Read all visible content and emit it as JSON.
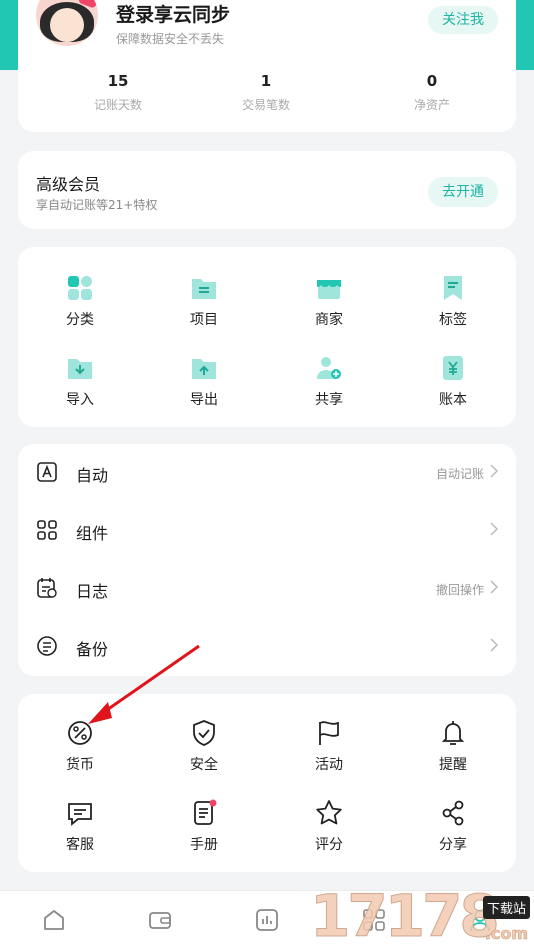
{
  "colors": {
    "accent": "#22c7b3",
    "accent_text": "#1db5a2",
    "pill_bg": "#e6f7f4",
    "annotation": "#e0141b"
  },
  "profile": {
    "name": "登录享云同步",
    "subtitle": "保障数据安全不丢失",
    "follow_label": "关注我",
    "stats": [
      {
        "value": "15",
        "label": "记账天数"
      },
      {
        "value": "1",
        "label": "交易笔数"
      },
      {
        "value": "0",
        "label": "净资产"
      }
    ]
  },
  "vip": {
    "title": "高级会员",
    "subtitle": "享自动记账等21+特权",
    "button": "去开通"
  },
  "tools": [
    {
      "label": "分类",
      "icon": "category-grid-icon"
    },
    {
      "label": "项目",
      "icon": "project-folder-icon"
    },
    {
      "label": "商家",
      "icon": "store-icon"
    },
    {
      "label": "标签",
      "icon": "bookmark-tag-icon"
    },
    {
      "label": "导入",
      "icon": "import-folder-icon"
    },
    {
      "label": "导出",
      "icon": "export-folder-icon"
    },
    {
      "label": "共享",
      "icon": "share-user-icon"
    },
    {
      "label": "账本",
      "icon": "ledger-yen-icon"
    }
  ],
  "list": [
    {
      "label": "自动",
      "right": "自动记账",
      "icon": "auto-letter-a-icon"
    },
    {
      "label": "组件",
      "right": "",
      "icon": "widgets-grid-icon"
    },
    {
      "label": "日志",
      "right": "撤回操作",
      "icon": "log-calendar-icon"
    },
    {
      "label": "备份",
      "right": "",
      "icon": "backup-icon"
    }
  ],
  "more": [
    {
      "label": "货币",
      "icon": "percent-currency-icon"
    },
    {
      "label": "安全",
      "icon": "shield-check-icon"
    },
    {
      "label": "活动",
      "icon": "flag-icon"
    },
    {
      "label": "提醒",
      "icon": "bell-icon"
    },
    {
      "label": "客服",
      "icon": "chat-bubble-icon"
    },
    {
      "label": "手册",
      "icon": "manual-book-icon"
    },
    {
      "label": "评分",
      "icon": "star-icon"
    },
    {
      "label": "分享",
      "icon": "share-icon"
    }
  ],
  "nav": [
    {
      "icon": "home-icon"
    },
    {
      "icon": "wallet-icon"
    },
    {
      "icon": "stats-icon"
    },
    {
      "icon": "apps-icon"
    },
    {
      "icon": "profile-icon"
    }
  ],
  "watermark": {
    "digits": "17178",
    "tag": "下载站",
    "domain": ".com"
  }
}
